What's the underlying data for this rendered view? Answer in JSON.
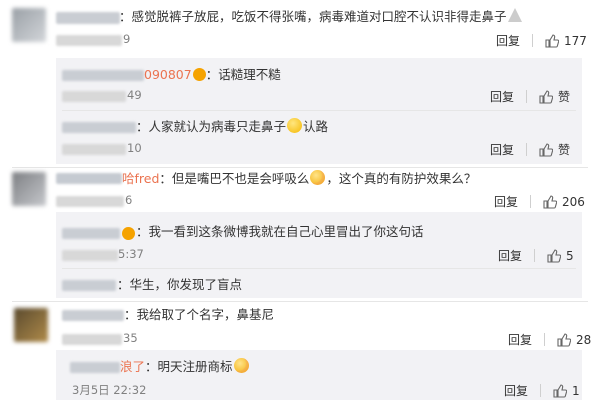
{
  "comments": [
    {
      "text": "：感觉脱裤子放屁，吃饭不得张嘴，病毒难道对口腔不认识非得走鼻子",
      "time_fragment": "9",
      "reply_label": "回复",
      "like_count": "177",
      "replies": [
        {
          "name_fragment": "090807",
          "text": "：话糙理不糙",
          "time_fragment": "49",
          "reply_label": "回复",
          "like_label": "赞"
        },
        {
          "name_fragment": "",
          "text_a": "：人家就认为病毒只走鼻子",
          "text_b": "认路",
          "time_fragment": "10",
          "reply_label": "回复",
          "like_label": "赞"
        }
      ]
    },
    {
      "name_fragment": "哈fred",
      "text_a": "：但是嘴巴不也是会呼吸么",
      "text_b": "，这个真的有防护效果么？",
      "time_fragment": "6",
      "reply_label": "回复",
      "like_count": "206",
      "replies": [
        {
          "text": "：我一看到这条微博我就在自己心里冒出了你这句话",
          "time_fragment": "5:37",
          "reply_label": "回复",
          "like_count": "5"
        },
        {
          "text": "：华生，你发现了盲点"
        }
      ]
    },
    {
      "text": "：我给取了个名字，鼻基尼",
      "time_fragment": "35",
      "reply_label": "回复",
      "like_count": "28",
      "replies": [
        {
          "name_fragment": "浪了",
          "text": "：明天注册商标",
          "time": "3月5日 22:32",
          "reply_label": "回复",
          "like_count": "1"
        }
      ]
    }
  ],
  "colors": {
    "username": "#eb7350",
    "reply_bg": "#f2f2f5",
    "meta": "#808080"
  }
}
